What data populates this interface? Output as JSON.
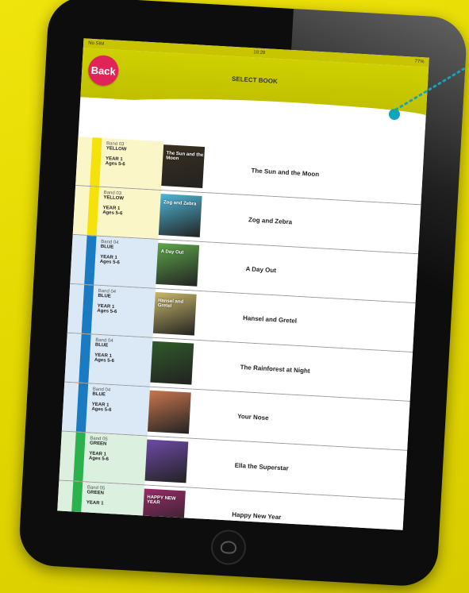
{
  "statusbar": {
    "left": "No SIM",
    "time": "18:28",
    "battery": "77%"
  },
  "header": {
    "back_label": "Back",
    "title": "SELECT BOOK"
  },
  "colors": {
    "yellow_band": "#f4e20a",
    "blue_band": "#1a7bc3",
    "green_band": "#2bb24c",
    "accent_back": "#e0245a",
    "header_bg": "#cfd000",
    "pointer": "#12a4bf"
  },
  "books": [
    {
      "band_label": "Band 03",
      "band_colour": "YELLOW",
      "year": "YEAR 1",
      "ages": "Ages 5-6",
      "title": "The Sun and the Moon",
      "cover_text": "The Sun and the Moon",
      "stripe": "#f4e20a",
      "tint": "#fbf6c8",
      "cover_bg": "#3a3020"
    },
    {
      "band_label": "Band 03",
      "band_colour": "YELLOW",
      "year": "YEAR 1",
      "ages": "Ages 5-6",
      "title": "Zog and Zebra",
      "cover_text": "Zog and Zebra",
      "stripe": "#f4e20a",
      "tint": "#fbf6c8",
      "cover_bg": "#4fb7d8"
    },
    {
      "band_label": "Band 04",
      "band_colour": "BLUE",
      "year": "YEAR 1",
      "ages": "Ages 5-6",
      "title": "A Day Out",
      "cover_text": "A Day Out",
      "stripe": "#1a7bc3",
      "tint": "#dbe9f6",
      "cover_bg": "#5fa64a"
    },
    {
      "band_label": "Band 04",
      "band_colour": "BLUE",
      "year": "YEAR 1",
      "ages": "Ages 5-6",
      "title": "Hansel and Gretel",
      "cover_text": "Hansel and Gretel",
      "stripe": "#1a7bc3",
      "tint": "#dbe9f6",
      "cover_bg": "#c9b86a"
    },
    {
      "band_label": "Band 04",
      "band_colour": "BLUE",
      "year": "YEAR 1",
      "ages": "Ages 5-6",
      "title": "The Rainforest at Night",
      "cover_text": "",
      "stripe": "#1a7bc3",
      "tint": "#dbe9f6",
      "cover_bg": "#2f5a2a"
    },
    {
      "band_label": "Band 04",
      "band_colour": "BLUE",
      "year": "YEAR 1",
      "ages": "Ages 5-6",
      "title": "Your Nose",
      "cover_text": "",
      "stripe": "#1a7bc3",
      "tint": "#dbe9f6",
      "cover_bg": "#c8764e"
    },
    {
      "band_label": "Band 05",
      "band_colour": "GREEN",
      "year": "YEAR 1",
      "ages": "Ages 5-6",
      "title": "Ella the Superstar",
      "cover_text": "",
      "stripe": "#2bb24c",
      "tint": "#dcf0df",
      "cover_bg": "#6e4aa8"
    },
    {
      "band_label": "Band 05",
      "band_colour": "GREEN",
      "year": "YEAR 1",
      "ages": "",
      "title": "Happy New Year",
      "cover_text": "HAPPY NEW YEAR",
      "stripe": "#2bb24c",
      "tint": "#dcf0df",
      "cover_bg": "#9a2a6a"
    }
  ]
}
